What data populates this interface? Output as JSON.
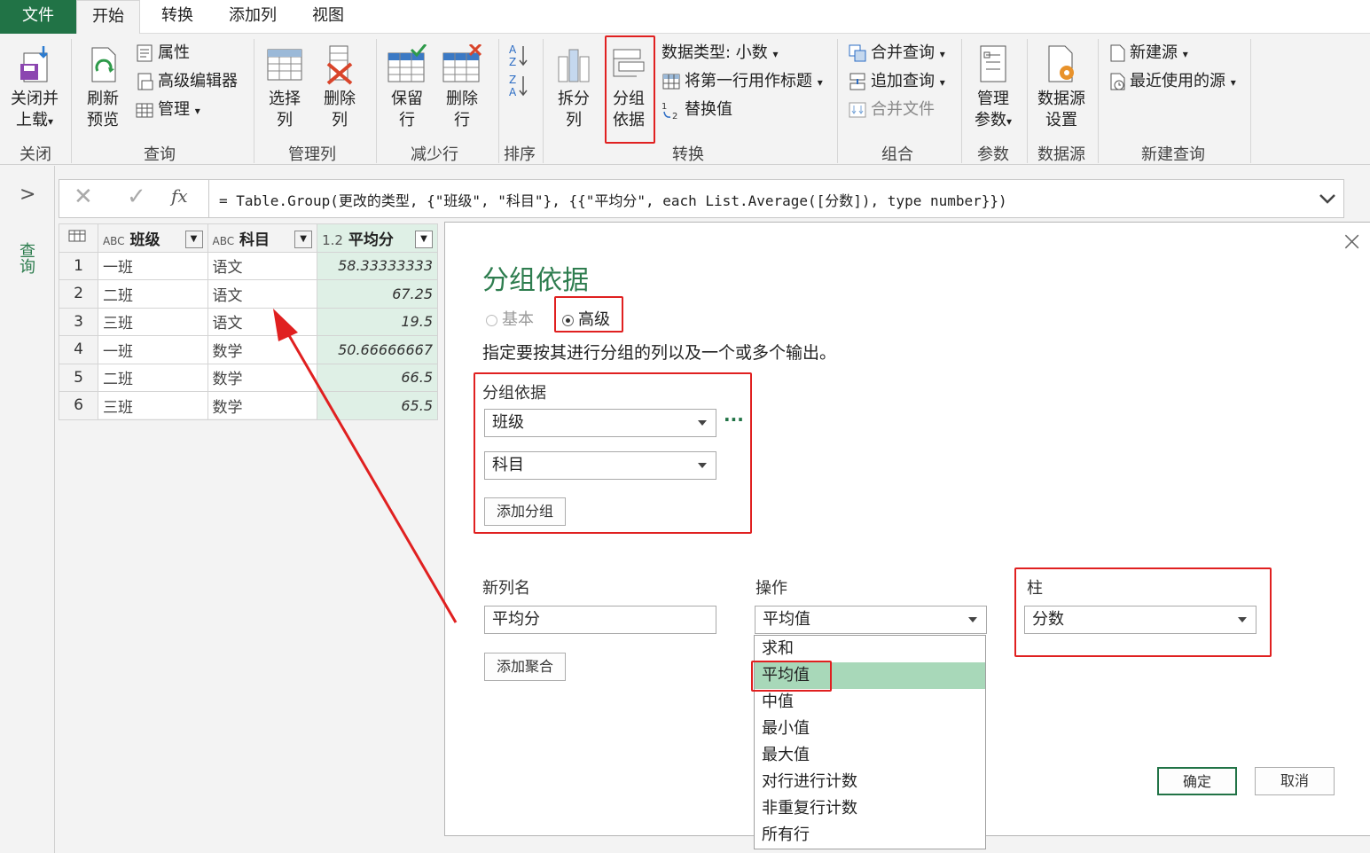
{
  "tabs": [
    "文件",
    "开始",
    "转换",
    "添加列",
    "视图"
  ],
  "ribbon": {
    "close": {
      "btn": "关闭并\n上载",
      "btn_arrow": "▾",
      "group": "关闭"
    },
    "query": {
      "refresh": "刷新\n预览",
      "props": "属性",
      "adv_editor": "高级编辑器",
      "manage": "管理",
      "group": "查询"
    },
    "manage_cols": {
      "choose": "选择\n列",
      "remove": "删除\n列",
      "group": "管理列"
    },
    "reduce_rows": {
      "keep": "保留\n行",
      "remove": "删除\n行",
      "group": "减少行"
    },
    "sort": {
      "group": "排序"
    },
    "transform": {
      "split": "拆分\n列",
      "groupby": "分组\n依据",
      "dtype": "数据类型: 小数",
      "first_row": "将第一行用作标题",
      "replace": "替换值",
      "group": "转换"
    },
    "combine": {
      "merge": "合并查询",
      "append": "追加查询",
      "combine_files": "合并文件",
      "group": "组合"
    },
    "params": {
      "manage": "管理\n参数",
      "group": "参数"
    },
    "datasource": {
      "settings": "数据源\n设置",
      "group": "数据源"
    },
    "newquery": {
      "new_source": "新建源",
      "recent": "最近使用的源",
      "group": "新建查询"
    }
  },
  "left_pane": {
    "label": "查询",
    "expand": ">"
  },
  "formula": {
    "text": "= Table.Group(更改的类型, {\"班级\", \"科目\"}, {{\"平均分\", each List.Average([分数]), type number}})",
    "fx": "fx"
  },
  "grid": {
    "columns": [
      {
        "type": "ABC",
        "name": "班级"
      },
      {
        "type": "ABC",
        "name": "科目"
      },
      {
        "type": "1.2",
        "name": "平均分"
      }
    ],
    "rows": [
      [
        "1",
        "一班",
        "语文",
        "58.33333333"
      ],
      [
        "2",
        "二班",
        "语文",
        "67.25"
      ],
      [
        "3",
        "三班",
        "语文",
        "19.5"
      ],
      [
        "4",
        "一班",
        "数学",
        "50.66666667"
      ],
      [
        "5",
        "二班",
        "数学",
        "66.5"
      ],
      [
        "6",
        "三班",
        "数学",
        "65.5"
      ]
    ]
  },
  "dialog": {
    "title": "分组依据",
    "basic": "基本",
    "advanced": "高级",
    "desc": "指定要按其进行分组的列以及一个或多个输出。",
    "groupby_label": "分组依据",
    "groupby_fields": [
      "班级",
      "科目"
    ],
    "more": "···",
    "add_group": "添加分组",
    "newcol_label": "新列名",
    "newcol_value": "平均分",
    "op_label": "操作",
    "op_value": "平均值",
    "col_label": "柱",
    "col_value": "分数",
    "add_agg": "添加聚合",
    "ops": [
      "求和",
      "平均值",
      "中值",
      "最小值",
      "最大值",
      "对行进行计数",
      "非重复行计数",
      "所有行"
    ],
    "ok": "确定",
    "cancel": "取消",
    "close": "×"
  },
  "colors": {
    "accent": "#217346",
    "dialog_title": "#2e7d4f",
    "highlight": "#e02020",
    "selected": "#a8d8b9"
  }
}
